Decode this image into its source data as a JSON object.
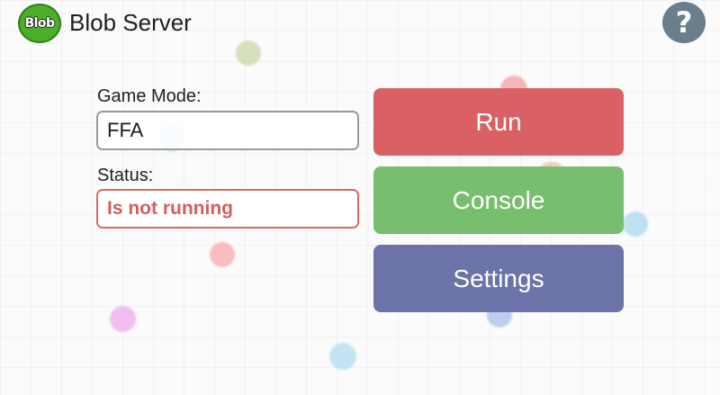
{
  "header": {
    "logo_text": "Blob",
    "title": "Blob Server",
    "help_icon": "question-mark-icon",
    "help_glyph": "?"
  },
  "form": {
    "game_mode_label": "Game Mode:",
    "game_mode_value": "FFA",
    "status_label": "Status:",
    "status_value": "Is not running"
  },
  "actions": {
    "run_label": "Run",
    "console_label": "Console",
    "settings_label": "Settings"
  },
  "colors": {
    "run": "#d96163",
    "console": "#77bf6e",
    "settings": "#6b73a8",
    "status_text": "#d25f5f",
    "help": "#6b7e8c",
    "logo": "#4caf2a"
  }
}
